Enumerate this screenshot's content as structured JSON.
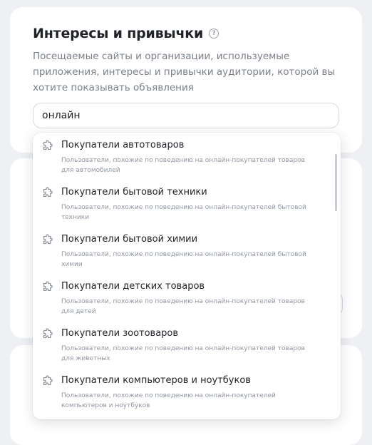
{
  "section": {
    "title": "Интересы и привычки",
    "help_icon": "question-circle-icon",
    "description": "Посещаемые сайты и организации, используемые приложения, интересы и привычки аудитории, которой вы хотите показывать объявления"
  },
  "search": {
    "value": "онлайн"
  },
  "dropdown": {
    "item_icon": "puzzle-piece-icon",
    "items": [
      {
        "title": "Покупатели автотоваров",
        "subtitle": "Пользователи, похожие по поведению на онлайн-покупателей товаров для автомобилей"
      },
      {
        "title": "Покупатели бытовой техники",
        "subtitle": "Пользователи, похожие по поведению на онлайн-покупателей бытовой техники"
      },
      {
        "title": "Покупатели бытовой химии",
        "subtitle": "Пользователи, похожие по поведению на онлайн-покупателей бытовой химии"
      },
      {
        "title": "Покупатели детских товаров",
        "subtitle": "Пользователи, похожие по поведению на онлайн-покупателей товаров для детей"
      },
      {
        "title": "Покупатели зоотоваров",
        "subtitle": "Пользователи, похожие по поведению на онлайн-покупателей товаров для животных"
      },
      {
        "title": "Покупатели компьютеров и ноутбуков",
        "subtitle": "Пользователи, похожие по поведению на онлайн-покупателей компьютеров и ноутбуков"
      }
    ]
  }
}
